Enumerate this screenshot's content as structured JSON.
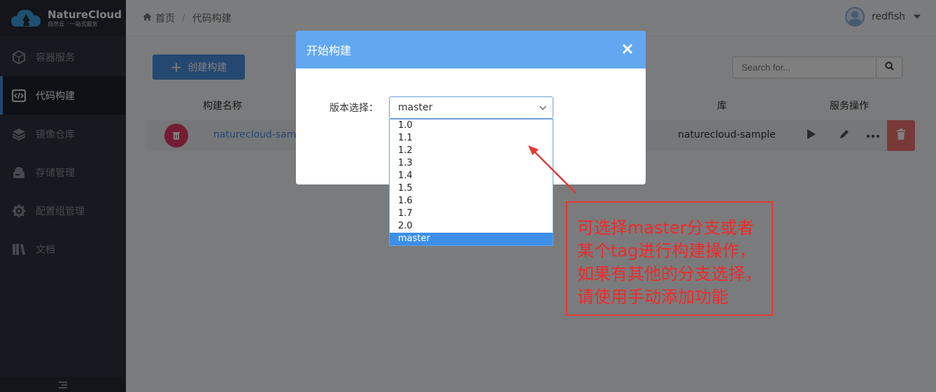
{
  "brand": {
    "name": "NatureCloud",
    "tagline": "自然云 · 一站式服务"
  },
  "sidebar": {
    "items": [
      {
        "label": "容器服务",
        "icon": "cube-icon"
      },
      {
        "label": "代码构建",
        "icon": "code-icon",
        "active": true
      },
      {
        "label": "镜像仓库",
        "icon": "layers-icon"
      },
      {
        "label": "存储管理",
        "icon": "storage-icon"
      },
      {
        "label": "配置组管理",
        "icon": "gear-icon"
      },
      {
        "label": "文档",
        "icon": "books-icon"
      }
    ]
  },
  "header": {
    "breadcrumb": {
      "home": "首页",
      "separator": "/",
      "current": "代码构建"
    },
    "user": {
      "name": "redfish"
    }
  },
  "toolbar": {
    "create_label": "创建构建",
    "search_placeholder": "Search for..."
  },
  "table": {
    "headers": {
      "name": "构建名称",
      "repo": "库",
      "actions": "服务操作"
    },
    "rows": [
      {
        "name": "naturecloud-sample",
        "repo": "naturecloud-sample"
      }
    ]
  },
  "modal": {
    "title": "开始构建",
    "field_label": "版本选择：",
    "selected": "master",
    "options": [
      "1.0",
      "1.1",
      "1.2",
      "1.3",
      "1.4",
      "1.5",
      "1.6",
      "1.7",
      "2.0",
      "master"
    ]
  },
  "annotation": {
    "lines": [
      "可选择master分支或者",
      "某个tag进行构建操作，",
      "如果有其他的分支选择，",
      "请使用手动添加功能"
    ],
    "color": "#ee2a2a"
  },
  "colors": {
    "primary": "#4a90e2",
    "modal_header": "#62a8f1",
    "danger": "#f27272",
    "sidebar": "#2f3340"
  }
}
